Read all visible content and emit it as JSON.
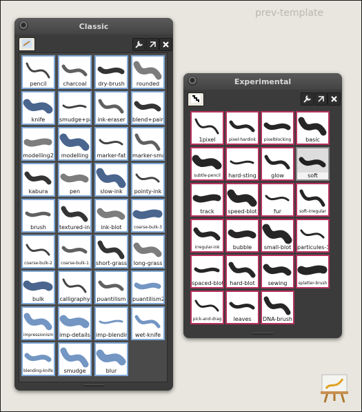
{
  "desktop": {
    "title": "prev-template"
  },
  "classic": {
    "title": "Classic",
    "brushes": [
      "pencil",
      "charcoal",
      "dry-brush",
      "rounded",
      "knife",
      "smudge+paint",
      "ink-eraser",
      "blend+paint",
      "modelling2",
      "modelling",
      "marker-fat",
      "marker-small",
      "kabura",
      "pen",
      "slow-ink",
      "pointy-ink",
      "brush",
      "textured-ink",
      "ink-blot",
      "coarse-bulk-3",
      "coarse-bulk-2",
      "coarse-bulk-1",
      "short-grass",
      "long-grass",
      "bulk",
      "calligraphy",
      "puantilism",
      "puantilism2",
      "impressionism",
      "imp-details",
      "imp-blending",
      "wet-knife",
      "blending-knife",
      "smudge",
      "blur"
    ]
  },
  "experimental": {
    "title": "Experimental",
    "selected": "soft",
    "brushes": [
      "1pixel",
      "pixel-hardink",
      "pixelblocking",
      "basic",
      "subtle-pencil",
      "hard-sting",
      "glow",
      "soft",
      "track",
      "speed-blot",
      "fur",
      "soft-irregular",
      "irregular-ink",
      "bubble",
      "small-blot",
      "particules-3",
      "spaced-blot",
      "hard-blot",
      "sewing",
      "splatter-brush",
      "pick-and-drag",
      "leaves",
      "DNA-brush"
    ]
  },
  "icons": {
    "settings": "wrench-icon",
    "undock": "arrow-icon",
    "close": "close-icon"
  }
}
